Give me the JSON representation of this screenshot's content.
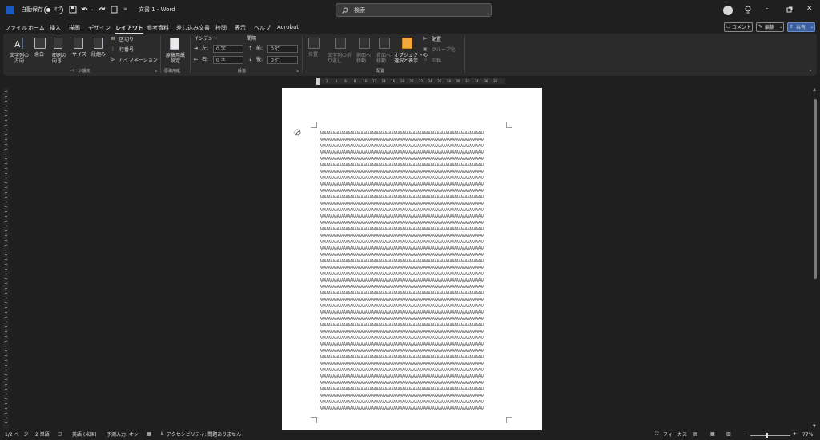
{
  "titlebar": {
    "autosave_label": "自動保存",
    "autosave_state": "オフ",
    "doc_title": "文書 1  -  Word",
    "search_placeholder": "検索",
    "icons": [
      "word-logo-icon",
      "save-icon",
      "undo-icon",
      "redo-icon",
      "new-icon",
      "customize-icon",
      "avatar-icon",
      "lightbulb-icon",
      "minimize-icon",
      "restore-icon",
      "close-icon"
    ]
  },
  "menu": {
    "tabs": [
      "ファイル",
      "ホーム",
      "挿入",
      "描画",
      "デザイン",
      "レイアウト",
      "参考資料",
      "差し込み文書",
      "校閲",
      "表示",
      "ヘルプ",
      "Acrobat"
    ],
    "active_tab": "レイアウト",
    "comment_label": "コメント",
    "edit_label": "編集",
    "share_label": "共有"
  },
  "ribbon": {
    "page_setup": {
      "text_direction": "文字列の\n方向",
      "margins": "余白",
      "orientation": "印刷の\n向き",
      "size": "サイズ",
      "columns": "段組み",
      "breaks": "区切り",
      "line_numbers": "行番号",
      "hyphenation": "ハイフネーション",
      "group_label": "ページ設定"
    },
    "manuscript": {
      "button": "原稿用紙\n設定",
      "group_label": "原稿用紙"
    },
    "paragraph": {
      "indent_label": "インデント",
      "spacing_label": "間隔",
      "left_label": "左:",
      "right_label": "右:",
      "before_label": "前:",
      "after_label": "後:",
      "left_value": "0 字",
      "right_value": "0 字",
      "before_value": "0 行",
      "after_value": "0 行",
      "group_label": "段落"
    },
    "arrange": {
      "position": "位置",
      "wrap_text": "文字列の折\nり返し",
      "bring_forward": "前面へ\n移動",
      "send_backward": "背面へ\n移動",
      "selection_pane": "オブジェクトの\n選択と表示",
      "align": "配置",
      "group": "グループ化",
      "rotate": "回転",
      "group_label": "配置"
    }
  },
  "ruler": {
    "ticks": [
      "2",
      "4",
      "6",
      "8",
      "10",
      "12",
      "14",
      "16",
      "18",
      "20",
      "22",
      "24",
      "26",
      "28",
      "30",
      "32",
      "34",
      "36",
      "38"
    ]
  },
  "document": {
    "line_text": "AAAAAAAAAAAAAAAAAAAAAAAAAAAAAAAAAAAAAAAAAAAAAAAAAAAAAAAAAAAAAAAAAAAAAAAAAAAA",
    "line_count": 44
  },
  "statusbar": {
    "page": "1/2 ページ",
    "words": "2 単語",
    "language": "英語 (米国)",
    "ime": "予測入力: オン",
    "accessibility": "アクセシビリティ: 問題ありません",
    "focus": "フォーカス",
    "zoom": "77%"
  }
}
